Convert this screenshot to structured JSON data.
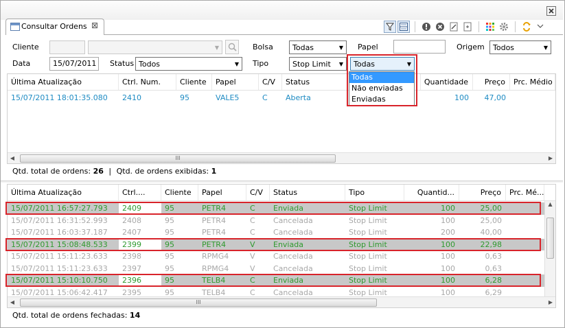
{
  "tab": {
    "title": "Consultar Ordens"
  },
  "filters": {
    "cliente_label": "Cliente",
    "cliente_value": "",
    "cliente_name": "",
    "bolsa_label": "Bolsa",
    "bolsa_value": "Todas",
    "papel_label": "Papel",
    "papel_value": "",
    "origem_label": "Origem",
    "origem_value": "Todos",
    "data_label": "Data",
    "data_value": "15/07/2011",
    "status_label": "Status",
    "status_value": "Todos",
    "tipo_label": "Tipo",
    "tipo_value": "Stop Limit",
    "envio_value": "Todas",
    "envio_options": [
      "Todas",
      "Não enviadas",
      "Enviadas"
    ]
  },
  "top_table": {
    "columns": [
      "Última Atualização",
      "Ctrl. Num.",
      "Cliente",
      "Papel",
      "C/V",
      "Status",
      "Quantidade",
      "Preço",
      "Prc. Médio"
    ],
    "rows": [
      {
        "ts": "15/07/2011 18:01:35.080",
        "ctrl": "2410",
        "cliente": "95",
        "papel": "VALE5",
        "cv": "C",
        "status": "Aberta",
        "qtd": "100",
        "preco": "47,00"
      }
    ]
  },
  "top_status": {
    "total_label": "Qtd. total de ordens:",
    "total": "26",
    "sep": "|",
    "exib_label": "Qtd. de ordens exibidas:",
    "exib": "1"
  },
  "bottom_table": {
    "columns": [
      "Última Atualização",
      "Ctrl....",
      "Cliente",
      "Papel",
      "C/V",
      "Status",
      "Tipo",
      "Quantid...",
      "Preço",
      "Prc. Mé..."
    ],
    "rows": [
      {
        "ts": "15/07/2011 16:57:27.793",
        "ctrl": "2409",
        "cliente": "95",
        "papel": "PETR4",
        "cv": "C",
        "status": "Enviada",
        "tipo": "Stop Limit",
        "qtd": "100",
        "preco": "25,00",
        "hl": true
      },
      {
        "ts": "15/07/2011 16:31:52.993",
        "ctrl": "2408",
        "cliente": "95",
        "papel": "PETR4",
        "cv": "C",
        "status": "Cancelada",
        "tipo": "Stop Limit",
        "qtd": "100",
        "preco": "25,00",
        "hl": false
      },
      {
        "ts": "15/07/2011 16:03:37.187",
        "ctrl": "2407",
        "cliente": "95",
        "papel": "PETR4",
        "cv": "C",
        "status": "Cancelada",
        "tipo": "Stop Limit",
        "qtd": "200",
        "preco": "40,00",
        "hl": false
      },
      {
        "ts": "15/07/2011 15:08:48.533",
        "ctrl": "2399",
        "cliente": "95",
        "papel": "PETR4",
        "cv": "V",
        "status": "Enviada",
        "tipo": "Stop Limit",
        "qtd": "100",
        "preco": "22,98",
        "hl": true
      },
      {
        "ts": "15/07/2011 15:11:23.633",
        "ctrl": "2398",
        "cliente": "95",
        "papel": "RPMG4",
        "cv": "V",
        "status": "Cancelada",
        "tipo": "Stop Limit",
        "qtd": "100",
        "preco": "0,63",
        "hl": false
      },
      {
        "ts": "15/07/2011 15:11:23.633",
        "ctrl": "2397",
        "cliente": "95",
        "papel": "RPMG4",
        "cv": "V",
        "status": "Cancelada",
        "tipo": "Stop Limit",
        "qtd": "100",
        "preco": "0,63",
        "hl": false
      },
      {
        "ts": "15/07/2011 15:10:10.750",
        "ctrl": "2396",
        "cliente": "95",
        "papel": "TELB4",
        "cv": "C",
        "status": "Enviada",
        "tipo": "Stop Limit",
        "qtd": "100",
        "preco": "6,28",
        "hl": true
      },
      {
        "ts": "15/07/2011 15:06:42.417",
        "ctrl": "2395",
        "cliente": "95",
        "papel": "TELB4",
        "cv": "C",
        "status": "Cancelada",
        "tipo": "Stop Limit",
        "qtd": "100",
        "preco": "6,29",
        "hl": false
      }
    ]
  },
  "bottom_status": {
    "label": "Qtd. total de ordens fechadas:",
    "value": "14"
  },
  "scroll_grip": "III",
  "colors": {
    "accent_blue": "#1e8bc3",
    "enviada_green": "#2f9a2f",
    "highlight": "#d8232a"
  }
}
